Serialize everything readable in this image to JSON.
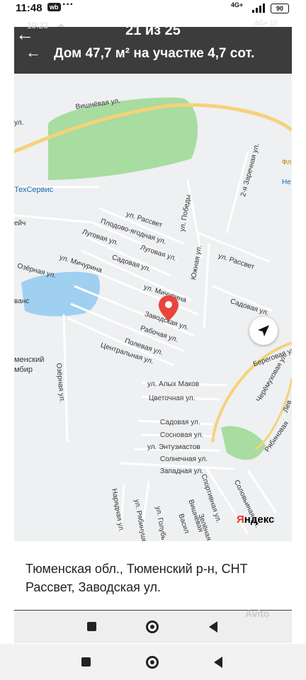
{
  "status": {
    "time": "11:48",
    "badge": "wb",
    "overflow": "···",
    "network": "4G+",
    "battery": "90"
  },
  "inner_status": {
    "time": "19:23",
    "right": "4G+",
    "battery": "10"
  },
  "viewer": {
    "counter": "21 из 25"
  },
  "listing": {
    "title": "Дом 47,7 м² на участке 4,7 сот."
  },
  "map": {
    "labels": [
      "Вишнёвая ул.",
      "ул.",
      "ТехСервис",
      "ейч",
      "ул. Рассвет",
      "ул. Победы",
      "Плодово-ягодная ул.",
      "Луговая ул.",
      "Луговая ул.",
      "ул. Мичурина",
      "Садовая ул.",
      "Озёрная ул.",
      "ул. Мичурина",
      "Садовая ул.",
      "ванс",
      "Заводская ул.",
      "Рабочая ул.",
      "Полевая ул.",
      "Центральная ул.",
      "Озёрная ул.",
      "менский",
      "мбир",
      "ул. Алых Маков",
      "Цветочная ул.",
      "Садовая ул.",
      "Сосновая ул.",
      "ул. Энтузиастов",
      "Солнечная ул.",
      "Западная ул.",
      "Южная ул.",
      "ул. Рассвет",
      "2-я Заречная ул.",
      "Береговая ул.",
      "Черёмуховая ул.",
      "Рябиновая",
      "Соловьиная ул.",
      "Спортивная ул.",
      "Вишнёвая",
      "Зелёная ул.",
      "Васил",
      "Нарядная ул.",
      "ул. Рябинушка",
      "ул. Голубь",
      "Фл",
      "Не",
      "Лев"
    ],
    "yandex_ya": "Я",
    "yandex_rest": "ндекс",
    "pin_color": "#e8453c",
    "park_color": "#a8dca0",
    "water_color": "#9fd0f0",
    "road_color": "#f5d27a"
  },
  "address": {
    "text": "Тюменская обл., Тюменский р-н, СНТ Рассвет, Заводская ул."
  },
  "watermark": "Avito"
}
